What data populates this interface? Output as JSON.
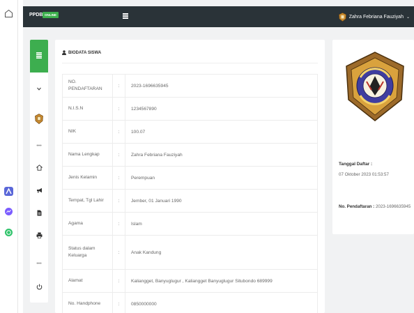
{
  "header": {
    "brand": "PPDB",
    "badge": "ONLINE",
    "user_name": "Zahra Febriana Fauziyah",
    "user_caret": "⌄"
  },
  "sidebar": {
    "dots_1": "•••",
    "dots_2": "•••"
  },
  "panel": {
    "title": "BIODATA SISWA",
    "rows": [
      {
        "label": "NO. PENDAFTARAN",
        "sep": ":",
        "value": "2023-1696635945"
      },
      {
        "label": "N.I.S.N",
        "sep": ":",
        "value": "1234567890"
      },
      {
        "label": "NIK",
        "sep": ":",
        "value": "100.07"
      },
      {
        "label": "Nama Lengkap",
        "sep": ":",
        "value": "Zahra Febriana Fauziyah"
      },
      {
        "label": "Jenis Kelamin",
        "sep": ":",
        "value": "Perempuan"
      },
      {
        "label": "Tempat, Tgl Lahir",
        "sep": ":",
        "value": "Jember, 01 Januari 1990"
      },
      {
        "label": "Agama",
        "sep": ":",
        "value": "Islam"
      },
      {
        "label": "Status dalam Keluarga",
        "sep": ":",
        "value": "Anak Kandung"
      },
      {
        "label": "Alamat",
        "sep": ":",
        "value": "Kaliangget, Banyuglugur , Kaliangget Banyuglugur Situbondo 689999"
      },
      {
        "label": "No. Handphone",
        "sep": ":",
        "value": "0850000000"
      }
    ]
  },
  "card": {
    "date_label": "Tanggal Daftar :",
    "date_value": "07 Oktober 2023 01:53:57",
    "noreg_label": "No. Pendaftaran :",
    "noreg_value": "2023-1696635945",
    "logo_text": "SMK KH. ABDUL WAHID ZAINI BANYUGLUGUR SITUBONDO"
  },
  "colors": {
    "topbar": "#2a3338",
    "accent_green": "#3dae4f",
    "background": "#f1f2f3"
  }
}
